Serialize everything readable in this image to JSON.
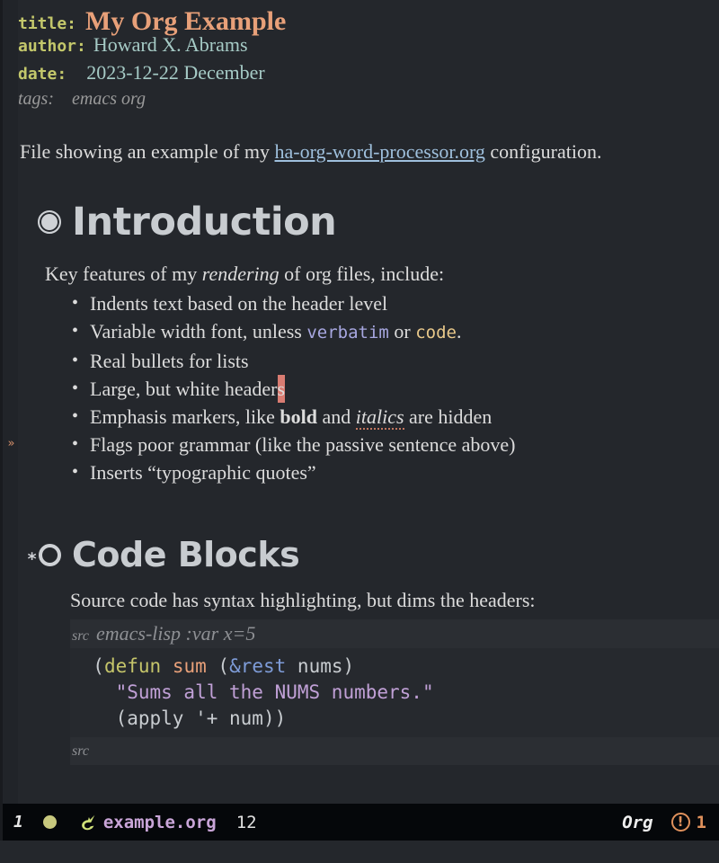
{
  "keywords": {
    "title_key": "title:",
    "title_value": "My Org Example",
    "author_key": "author:",
    "author_value": "Howard X. Abrams",
    "date_key": "date:",
    "date_value": "2023-12-22 December",
    "tags_key": "tags:",
    "tags_value": "emacs org"
  },
  "intro_paragraph": {
    "before_link": "File showing an example of my ",
    "link_text": "ha-org-word-processor.org",
    "after_link": " configuration."
  },
  "sections": [
    {
      "bullet_icon": "filled-ring-bullet-icon",
      "heading": "Introduction",
      "lead_before": "Key features of my ",
      "lead_emphasis": "rendering",
      "lead_after": " of org files, include:",
      "items": [
        {
          "text": "Indents text based on the header level"
        },
        {
          "text_a": "Variable width font, unless ",
          "verbatim": "verbatim",
          "text_b": " or ",
          "code": "code",
          "text_c": "."
        },
        {
          "text": "Real bullets for lists"
        },
        {
          "text_a": "Large, but white header",
          "cursor_char": "s"
        },
        {
          "text_a": "Emphasis markers, like ",
          "bold": "bold",
          "text_b": " and ",
          "italic": "italics",
          "text_c": " are hidden"
        },
        {
          "text": "Flags poor grammar (like the passive sentence above)"
        },
        {
          "text": "Inserts “typographic quotes”"
        }
      ]
    },
    {
      "star_prefix": "*",
      "bullet_icon": "hollow-ring-bullet-icon",
      "heading": "Code Blocks",
      "lead": "Source code has syntax highlighting, but dims the headers:"
    }
  ],
  "src_block": {
    "begin_tag": "src",
    "begin_args": "emacs-lisp :var x=5",
    "end_tag": "src",
    "lines": [
      {
        "indent": "  ",
        "tokens": [
          {
            "t": "(",
            "c": "plain"
          },
          {
            "t": "defun",
            "c": "keyword"
          },
          {
            "t": " ",
            "c": "plain"
          },
          {
            "t": "sum",
            "c": "function"
          },
          {
            "t": " (",
            "c": "plain"
          },
          {
            "t": "&rest",
            "c": "arg"
          },
          {
            "t": " nums)",
            "c": "plain"
          }
        ]
      },
      {
        "indent": "    ",
        "tokens": [
          {
            "t": "\"Sums all the NUMS numbers.\"",
            "c": "string"
          }
        ]
      },
      {
        "indent": "    ",
        "tokens": [
          {
            "t": "(apply '+ num))",
            "c": "plain"
          }
        ]
      }
    ]
  },
  "fringe": {
    "continuation_marker": "»"
  },
  "modeline": {
    "window_number": "1",
    "status_dot_color": "#c8c87e",
    "buffer_icon": "org-mode-unicorn-icon",
    "buffer_name": "example.org",
    "position": "12",
    "major_mode": "Org",
    "error_icon": "error-circle-icon",
    "error_count": "1",
    "error_color": "#e0915c"
  },
  "colors": {
    "background": "#24272c",
    "modeline_bg": "#05070a",
    "keyword": "#c3c76b",
    "value": "#a6cbc6",
    "title": "#e8a079",
    "link": "#9fc0dd",
    "text": "#dcdcdc",
    "heading": "#c8ccd0",
    "verbatim": "#a7a7e0",
    "code": "#e8c88a",
    "cursor": "#d97c72"
  }
}
